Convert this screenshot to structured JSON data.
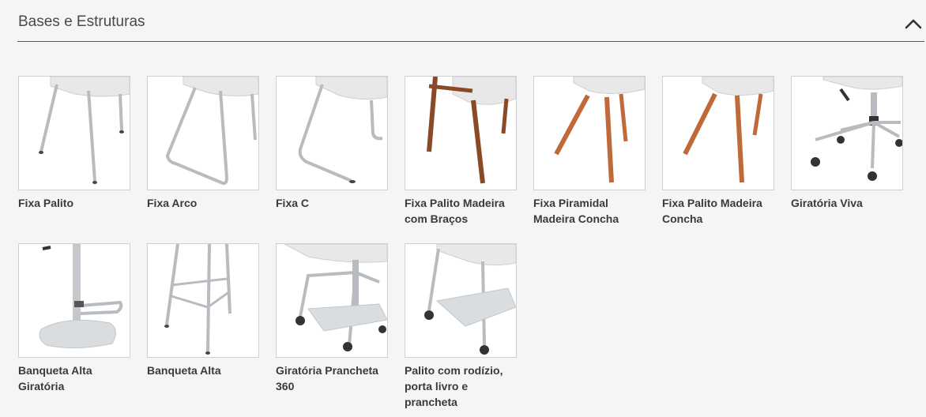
{
  "section": {
    "title": "Bases e Estruturas",
    "toggle_icon": "chevron-up-icon"
  },
  "items": [
    {
      "label": "Fixa Palito",
      "icon": "chair-base-palito-image"
    },
    {
      "label": "Fixa Arco",
      "icon": "chair-base-arco-image"
    },
    {
      "label": "Fixa C",
      "icon": "chair-base-c-image"
    },
    {
      "label": "Fixa Palito Madeira com Braços",
      "icon": "chair-base-palito-madeira-bracos-image"
    },
    {
      "label": "Fixa Piramidal Madeira Concha",
      "icon": "chair-base-piramidal-madeira-image"
    },
    {
      "label": "Fixa Palito Madeira Concha",
      "icon": "chair-base-palito-madeira-concha-image"
    },
    {
      "label": "Giratória Viva",
      "icon": "chair-base-giratoria-image"
    },
    {
      "label": "Banqueta Alta Giratória",
      "icon": "stool-base-giratoria-image"
    },
    {
      "label": "Banqueta Alta",
      "icon": "stool-base-fixed-image"
    },
    {
      "label": "Giratória Prancheta 360",
      "icon": "chair-base-prancheta-360-image"
    },
    {
      "label": "Palito com rodízio, porta livro e prancheta",
      "icon": "chair-base-rodizio-image"
    }
  ],
  "colors": {
    "background": "#f5f5f5",
    "metal": "#b8bcc0",
    "wood": "#c0693a",
    "dark_wood": "#8a4a28",
    "seat": "#e6e6e6"
  }
}
